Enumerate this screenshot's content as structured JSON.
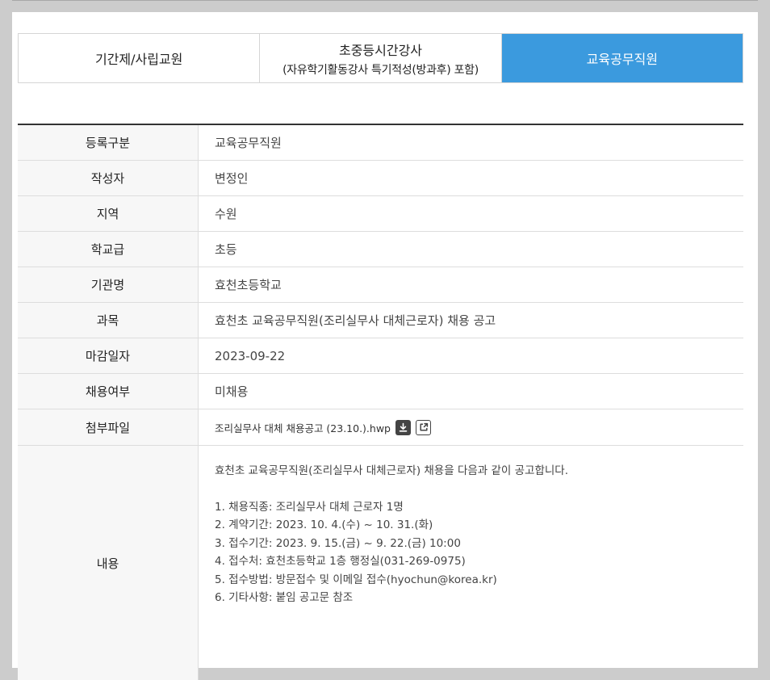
{
  "tabs": [
    {
      "label": "기간제/사립교원",
      "sub": "",
      "active": false
    },
    {
      "label": "초중등시간강사",
      "sub": "(자유학기활동강사 특기적성(방과후) 포함)",
      "active": false
    },
    {
      "label": "교육공무직원",
      "sub": "",
      "active": true
    }
  ],
  "detail": {
    "rows": [
      {
        "label": "등록구분",
        "value": "교육공무직원"
      },
      {
        "label": "작성자",
        "value": "변정인"
      },
      {
        "label": "지역",
        "value": "수원"
      },
      {
        "label": "학교급",
        "value": "초등"
      },
      {
        "label": "기관명",
        "value": "효천초등학교"
      },
      {
        "label": "과목",
        "value": "효천초 교육공무직원(조리실무사 대체근로자) 채용 공고"
      },
      {
        "label": "마감일자",
        "value": "2023-09-22"
      },
      {
        "label": "채용여부",
        "value": "미채용"
      }
    ],
    "attachment": {
      "label": "첨부파일",
      "filename": "조리실무사 대체 채용공고 (23.10.).hwp",
      "download_icon": "download-icon",
      "open_icon": "external-link-icon"
    },
    "content": {
      "label": "내용",
      "lines": [
        "효천초 교육공무직원(조리실무사 대체근로자) 채용을 다음과 같이 공고합니다.",
        "",
        "1. 채용직종: 조리실무사 대체 근로자 1명",
        "2. 계약기간: 2023. 10. 4.(수) ~ 10. 31.(화)",
        "3. 접수기간: 2023. 9. 15.(금) ~ 9. 22.(금) 10:00",
        "4. 접수처: 효천초등학교 1층 행정실(031-269-0975)",
        "5. 접수방법: 방문접수 및 이메일 접수(hyochun@korea.kr)",
        "6. 기타사항: 붙임 공고문 참조"
      ]
    }
  },
  "colors": {
    "active_tab": "#3b9ade",
    "page_bg": "#cccccc"
  }
}
